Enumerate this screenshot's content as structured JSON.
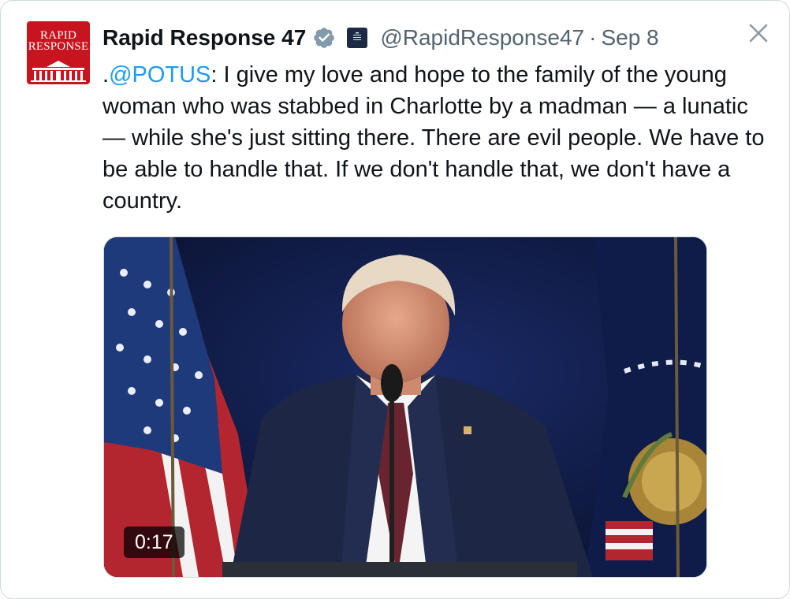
{
  "account": {
    "display_name": "Rapid Response 47",
    "handle": "@RapidResponse47",
    "separator": "·",
    "date": "Sep 8",
    "avatar_text_line1": "RAPID",
    "avatar_text_line2": "RESPONSE",
    "avatar_color": "#c8141e"
  },
  "tweet": {
    "prefix": ".",
    "mention": "@POTUS",
    "body": ": I give my love and hope to the family of the young woman who was stabbed in Charlotte by a madman — a lunatic — while she's just sitting there. There are evil people. We have to be able to handle that. If we don't handle that, we don't have a country."
  },
  "media": {
    "duration": "0:17"
  },
  "icons": {
    "verified": "verified-badge-icon",
    "affiliation": "white-house-badge-icon",
    "close": "close-icon"
  },
  "colors": {
    "link": "#1d9bf0",
    "secondary_text": "#536471",
    "verified": "#829aab"
  }
}
